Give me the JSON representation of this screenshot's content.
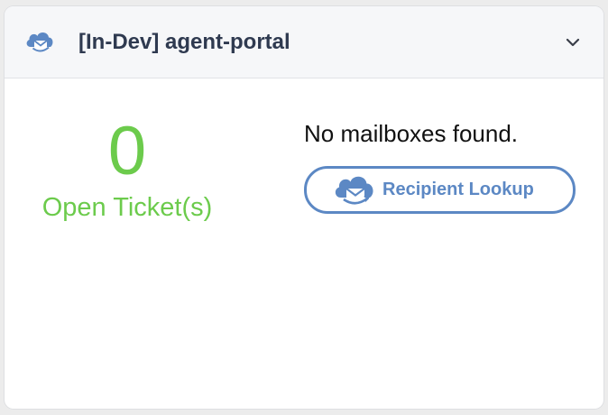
{
  "widget": {
    "title": "[In-Dev] agent-portal",
    "logo_icon": "cloud-mail-icon",
    "toggle_icon": "chevron-down-icon"
  },
  "tickets": {
    "count": "0",
    "label": "Open Ticket(s)"
  },
  "mailboxes": {
    "empty_message": "No mailboxes found.",
    "lookup_button_label": "Recipient Lookup",
    "lookup_button_icon": "cloud-mail-icon"
  },
  "colors": {
    "accent_blue": "#5c88c4",
    "ticket_green": "#6ccb4c",
    "title_text": "#2f3a50",
    "header_background": "#f6f7f9"
  }
}
